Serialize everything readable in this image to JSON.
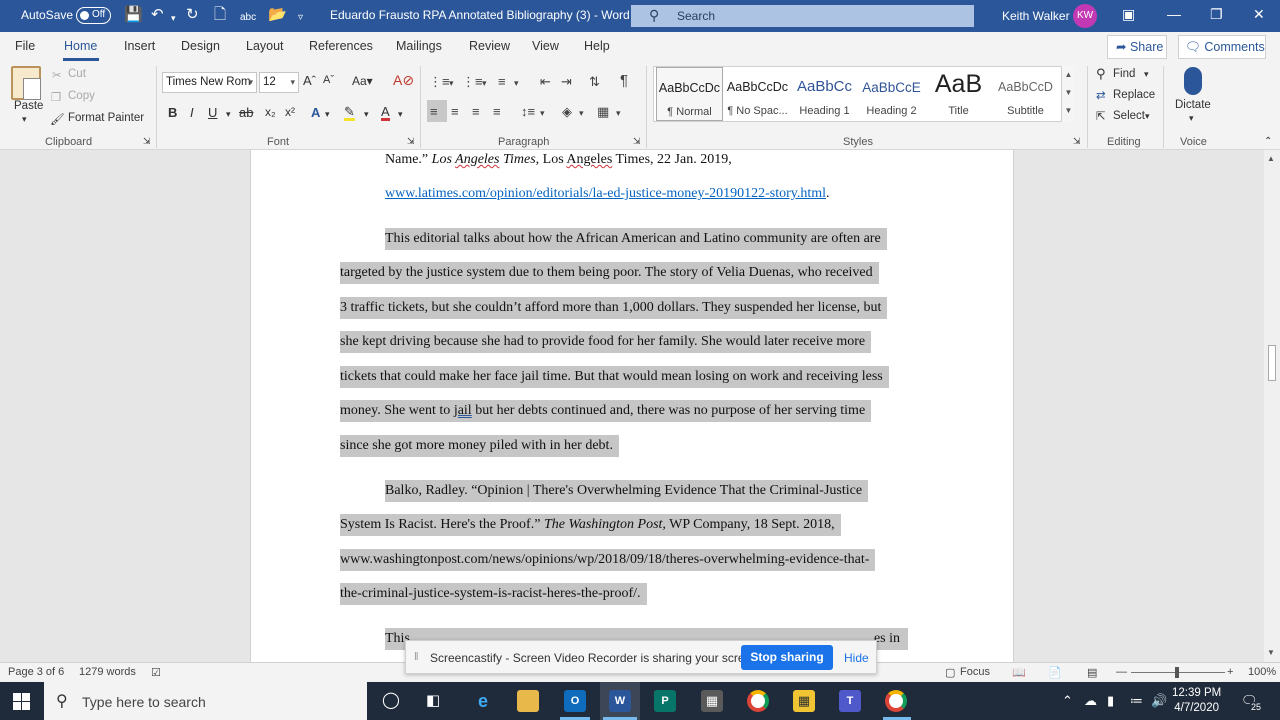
{
  "titlebar": {
    "autosave": "AutoSave",
    "autosave_state": "Off",
    "document_title": "Eduardo Frausto RPA Annotated Bibliography (3)  -  Word",
    "search_placeholder": "Search",
    "user_name": "Keith Walker",
    "user_initials": "KW"
  },
  "tabs": [
    "File",
    "Home",
    "Insert",
    "Design",
    "Layout",
    "References",
    "Mailings",
    "Review",
    "View",
    "Help"
  ],
  "active_tab": "Home",
  "share_label": "Share",
  "comments_label": "Comments",
  "ribbon": {
    "clipboard": {
      "paste": "Paste",
      "cut": "Cut",
      "copy": "Copy",
      "format_painter": "Format Painter",
      "label": "Clipboard"
    },
    "font": {
      "name": "Times New Rom",
      "size": "12",
      "label": "Font"
    },
    "paragraph": {
      "label": "Paragraph"
    },
    "styles": {
      "label": "Styles",
      "items": [
        {
          "preview": "AaBbCcDc",
          "name": "¶ Normal"
        },
        {
          "preview": "AaBbCcDc",
          "name": "¶ No Spac..."
        },
        {
          "preview": "AaBbCc",
          "name": "Heading 1"
        },
        {
          "preview": "AaBbCcE",
          "name": "Heading 2"
        },
        {
          "preview": "AaB",
          "name": "Title"
        },
        {
          "preview": "AaBbCcD",
          "name": "Subtitle"
        }
      ]
    },
    "editing": {
      "find": "Find",
      "replace": "Replace",
      "select": "Select",
      "label": "Editing"
    },
    "voice": {
      "dictate": "Dictate",
      "label": "Voice"
    }
  },
  "document": {
    "p1_line1_a": "Name.” ",
    "p1_line1_b": "Los ",
    "p1_line1_c": "Angeles",
    "p1_line1_d": " Times",
    "p1_line1_e": ", Los ",
    "p1_line1_f": "Angeles",
    "p1_line1_g": " Times, 22 Jan. 2019,",
    "p1_link": "www.latimes.com/opinion/editorials/la-ed-justice-money-20190122-story.html",
    "p1_link_end": ".",
    "p2_lines": [
      "This editorial talks about how the African American and Latino community are often are",
      "targeted by the justice system due to them being poor. The story of Velia Duenas, who received",
      "3 traffic tickets, but she couldn’t afford more than 1,000 dollars. They suspended her license, but",
      "she kept driving because she had to provide food for her family. She would later receive more",
      "tickets that could make her face jail time. But that would mean losing on work and receiving less"
    ],
    "p2_line6_a": "money. She went to ",
    "p2_line6_b": "jail",
    "p2_line6_c": " but her debts continued and, there was no purpose of her serving time",
    "p2_line7": "since she got more money piled with in her debt.",
    "p3_line1": "Balko, Radley. “Opinion | There's Overwhelming Evidence That the Criminal-Justice",
    "p3_line2_a": "System Is Racist. Here's the Proof.” ",
    "p3_line2_b": "The Washington Post,",
    "p3_line2_c": " WP Company, 18 Sept. 2018,",
    "p3_line3": "www.washingtonpost.com/news/opinions/wp/2018/09/18/theres-overwhelming-evidence-that-",
    "p3_line4": "the-criminal-justice-system-is-racist-heres-the-proof/.",
    "p4_line1_a": "This",
    "p4_line1_b": "es in"
  },
  "statusbar": {
    "page": "Page 3 of 6",
    "words": "1279 words",
    "focus": "Focus",
    "zoom": "100%"
  },
  "screencast": {
    "message": "Screencastify - Screen Video Recorder is sharing your screen.",
    "stop": "Stop sharing",
    "hide": "Hide"
  },
  "taskbar": {
    "search_placeholder": "Type here to search",
    "time": "12:39 PM",
    "date": "4/7/2020",
    "notification_count": "25"
  }
}
